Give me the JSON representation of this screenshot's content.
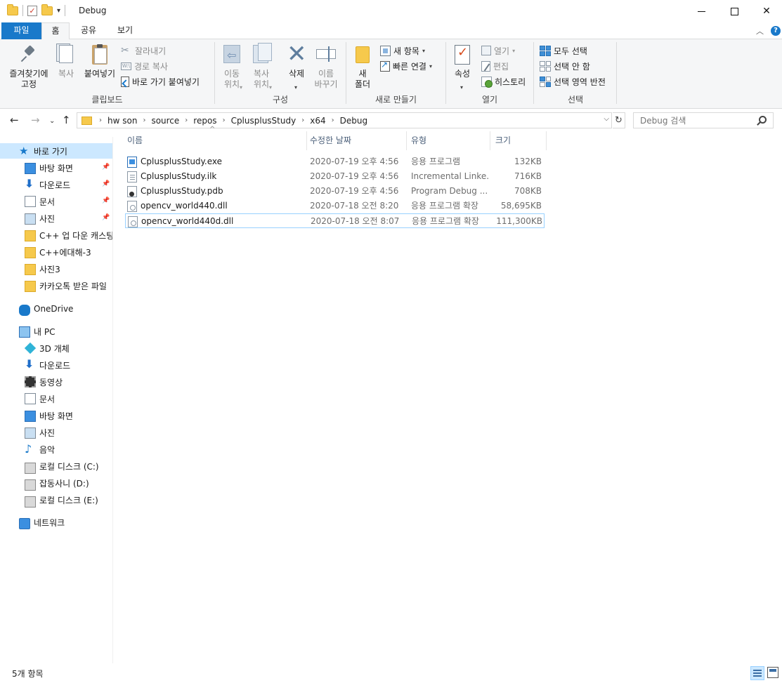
{
  "window": {
    "title": "Debug"
  },
  "tabs": [
    {
      "label": "파일"
    },
    {
      "label": "홈"
    },
    {
      "label": "공유"
    },
    {
      "label": "보기"
    }
  ],
  "ribbon": {
    "clipboard": {
      "label": "클립보드",
      "pin_quick_access": "즐겨찾기에\n고정",
      "copy": "복사",
      "paste": "붙여넣기",
      "cut": "잘라내기",
      "copy_path": "경로 복사",
      "paste_shortcut": "바로 가기 붙여넣기"
    },
    "organize": {
      "label": "구성",
      "move_to": "이동\n위치",
      "copy_to": "복사\n위치",
      "delete": "삭제",
      "rename": "이름\n바꾸기"
    },
    "new": {
      "label": "새로 만들기",
      "new_folder": "새\n폴더",
      "new_item": "새 항목",
      "easy_access": "빠른 연결"
    },
    "open": {
      "label": "열기",
      "properties": "속성",
      "open": "열기",
      "edit": "편집",
      "history": "히스토리"
    },
    "select": {
      "label": "선택",
      "select_all": "모두 선택",
      "select_none": "선택 안 함",
      "invert_selection": "선택 영역 반전"
    }
  },
  "address": {
    "breadcrumbs": [
      "hw son",
      "source",
      "repos",
      "CplusplusStudy",
      "x64",
      "Debug"
    ],
    "search_placeholder": "Debug 검색"
  },
  "nav": {
    "quick_access": "바로 가기",
    "quick_items": [
      {
        "label": "바탕 화면",
        "icon": "desktop-icon",
        "pinned": true
      },
      {
        "label": "다운로드",
        "icon": "download-icon",
        "pinned": true
      },
      {
        "label": "문서",
        "icon": "document-icon",
        "pinned": true
      },
      {
        "label": "사진",
        "icon": "pictures-icon",
        "pinned": true
      },
      {
        "label": "C++ 업 다운 캐스팅",
        "icon": "folder-icon",
        "pinned": false
      },
      {
        "label": "C++에대해-3",
        "icon": "folder-icon",
        "pinned": false
      },
      {
        "label": "사진3",
        "icon": "folder-icon",
        "pinned": false
      },
      {
        "label": "카카오톡 받은 파일",
        "icon": "folder-icon",
        "pinned": false
      }
    ],
    "onedrive": "OneDrive",
    "this_pc": "내 PC",
    "pc_items": [
      {
        "label": "3D 개체",
        "icon": "3d-objects-icon"
      },
      {
        "label": "다운로드",
        "icon": "download-icon"
      },
      {
        "label": "동영상",
        "icon": "video-icon"
      },
      {
        "label": "문서",
        "icon": "document-icon"
      },
      {
        "label": "바탕 화면",
        "icon": "desktop-icon"
      },
      {
        "label": "사진",
        "icon": "pictures-icon"
      },
      {
        "label": "음악",
        "icon": "music-icon"
      },
      {
        "label": "로컬 디스크 (C:)",
        "icon": "drive-c-icon"
      },
      {
        "label": "잡동사니 (D:)",
        "icon": "drive-d-icon"
      },
      {
        "label": "로컬 디스크 (E:)",
        "icon": "drive-e-icon"
      }
    ],
    "network": "네트워크"
  },
  "filelist": {
    "columns": {
      "name": "이름",
      "date": "수정한 날짜",
      "type": "유형",
      "size": "크기"
    },
    "files": [
      {
        "name": "CplusplusStudy.exe",
        "date": "2020-07-19 오후 4:56",
        "type": "응용 프로그램",
        "size": "132KB",
        "icon": "exe-file-icon"
      },
      {
        "name": "CplusplusStudy.ilk",
        "date": "2020-07-19 오후 4:56",
        "type": "Incremental Linke...",
        "size": "716KB",
        "icon": "ilk-file-icon"
      },
      {
        "name": "CplusplusStudy.pdb",
        "date": "2020-07-19 오후 4:56",
        "type": "Program Debug ...",
        "size": "708KB",
        "icon": "pdb-file-icon"
      },
      {
        "name": "opencv_world440.dll",
        "date": "2020-07-18 오전 8:20",
        "type": "응용 프로그램 확장",
        "size": "58,695KB",
        "icon": "dll-file-icon"
      },
      {
        "name": "opencv_world440d.dll",
        "date": "2020-07-18 오전 8:07",
        "type": "응용 프로그램 확장",
        "size": "111,300KB",
        "icon": "dll-file-icon"
      }
    ]
  },
  "status": {
    "item_count": "5개 항목"
  }
}
